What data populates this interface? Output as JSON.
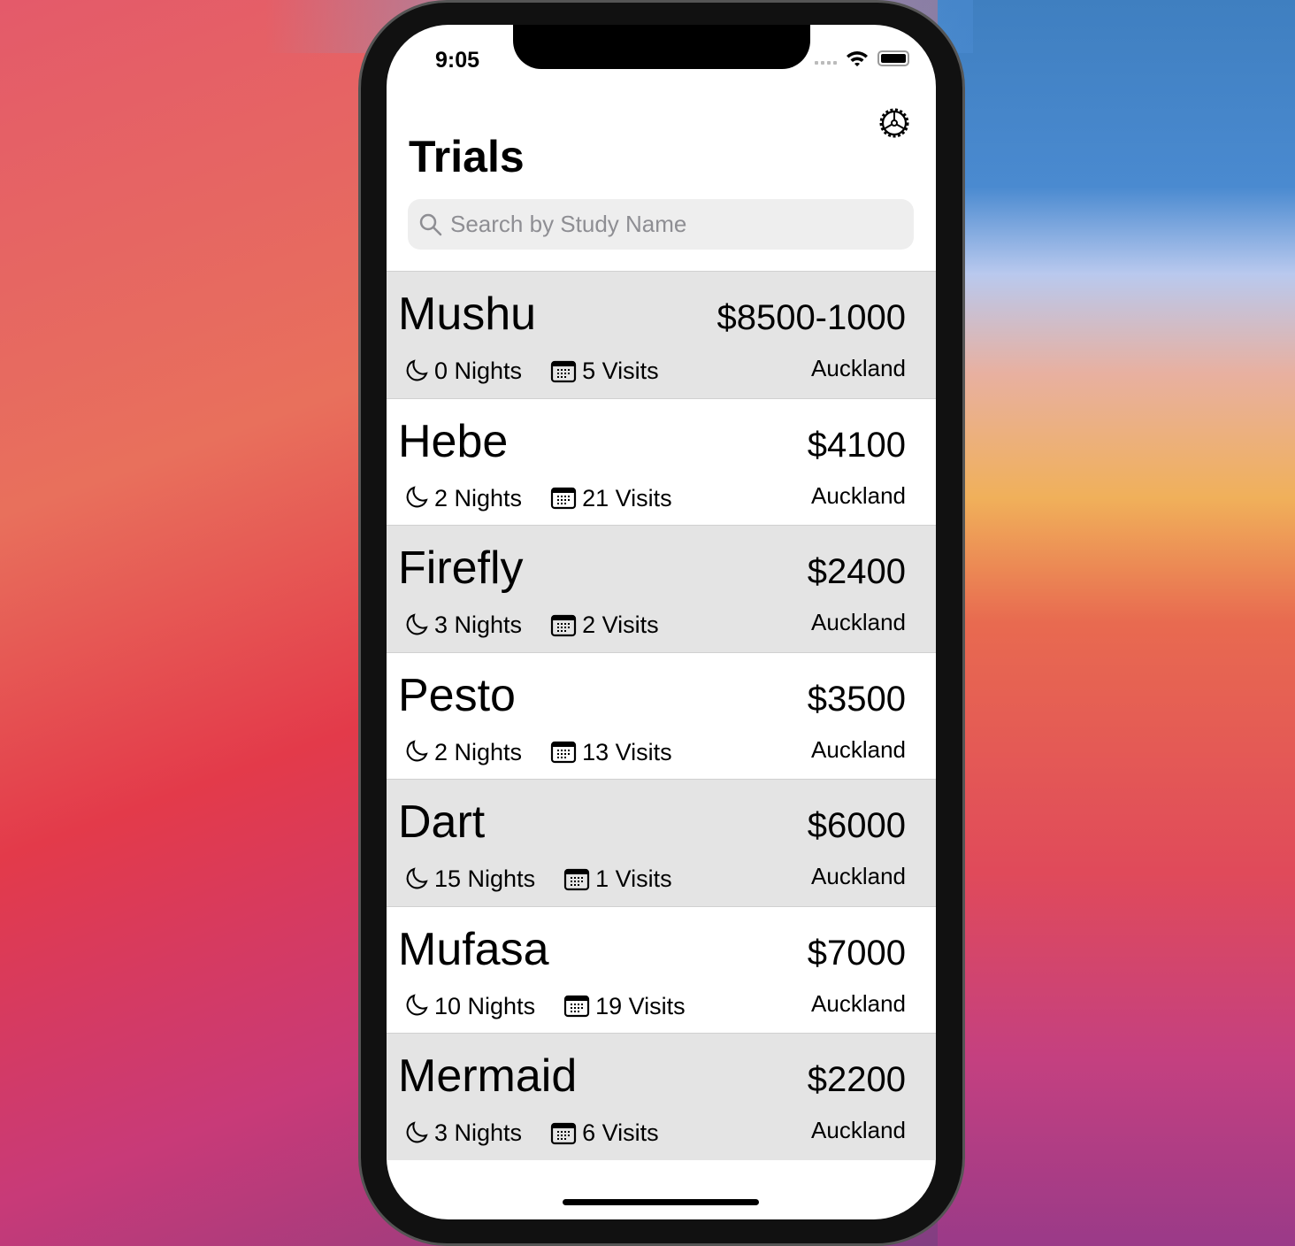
{
  "status_bar": {
    "time": "9:05"
  },
  "header": {
    "title": "Trials",
    "settings_icon": "gear-icon"
  },
  "search": {
    "placeholder": "Search by Study Name",
    "value": ""
  },
  "trials": [
    {
      "name": "Mushu",
      "price": "$8500-1000",
      "nights": "0 Nights",
      "visits": "5 Visits",
      "location": "Auckland"
    },
    {
      "name": "Hebe",
      "price": "$4100",
      "nights": "2 Nights",
      "visits": "21 Visits",
      "location": "Auckland"
    },
    {
      "name": "Firefly",
      "price": "$2400",
      "nights": "3 Nights",
      "visits": "2 Visits",
      "location": "Auckland"
    },
    {
      "name": "Pesto",
      "price": "$3500",
      "nights": "2 Nights",
      "visits": "13 Visits",
      "location": "Auckland"
    },
    {
      "name": "Dart",
      "price": "$6000",
      "nights": "15 Nights",
      "visits": "1 Visits",
      "location": "Auckland"
    },
    {
      "name": "Mufasa",
      "price": "$7000",
      "nights": "10 Nights",
      "visits": "19 Visits",
      "location": "Auckland"
    },
    {
      "name": "Mermaid",
      "price": "$2200",
      "nights": "3 Nights",
      "visits": "6 Visits",
      "location": "Auckland"
    }
  ],
  "colors": {
    "row_alt": "#e4e4e4",
    "search_bg": "#eeeeee",
    "placeholder": "#8e8e93"
  }
}
